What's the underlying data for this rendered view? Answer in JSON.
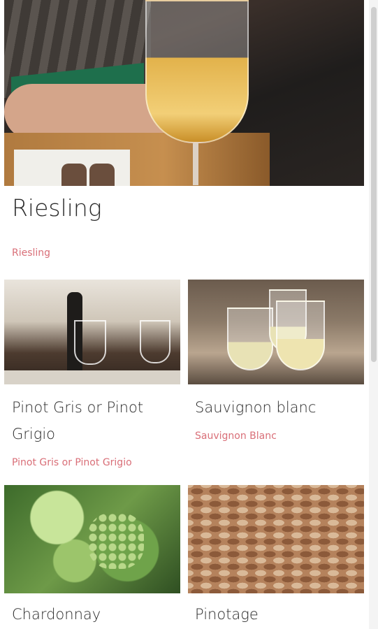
{
  "posts": [
    {
      "title": "Riesling",
      "category": "Riesling",
      "image": "riesling-wine-glass-photo"
    },
    {
      "title": "Pinot Gris or Pinot Grigio",
      "category": "Pinot Gris or Pinot Grigio",
      "image": "restaurant-table-wine-photo"
    },
    {
      "title": "Sauvignon blanc",
      "category": "Sauvignon Blanc",
      "image": "toasting-wine-glasses-photo"
    },
    {
      "title": "Chardonnay",
      "category": "",
      "image": "grape-vine-photo"
    },
    {
      "title": "Pinotage",
      "category": "",
      "image": "wine-corks-photo"
    }
  ],
  "colors": {
    "category_link": "#d96f78",
    "title_text": "#2b2b2b"
  }
}
